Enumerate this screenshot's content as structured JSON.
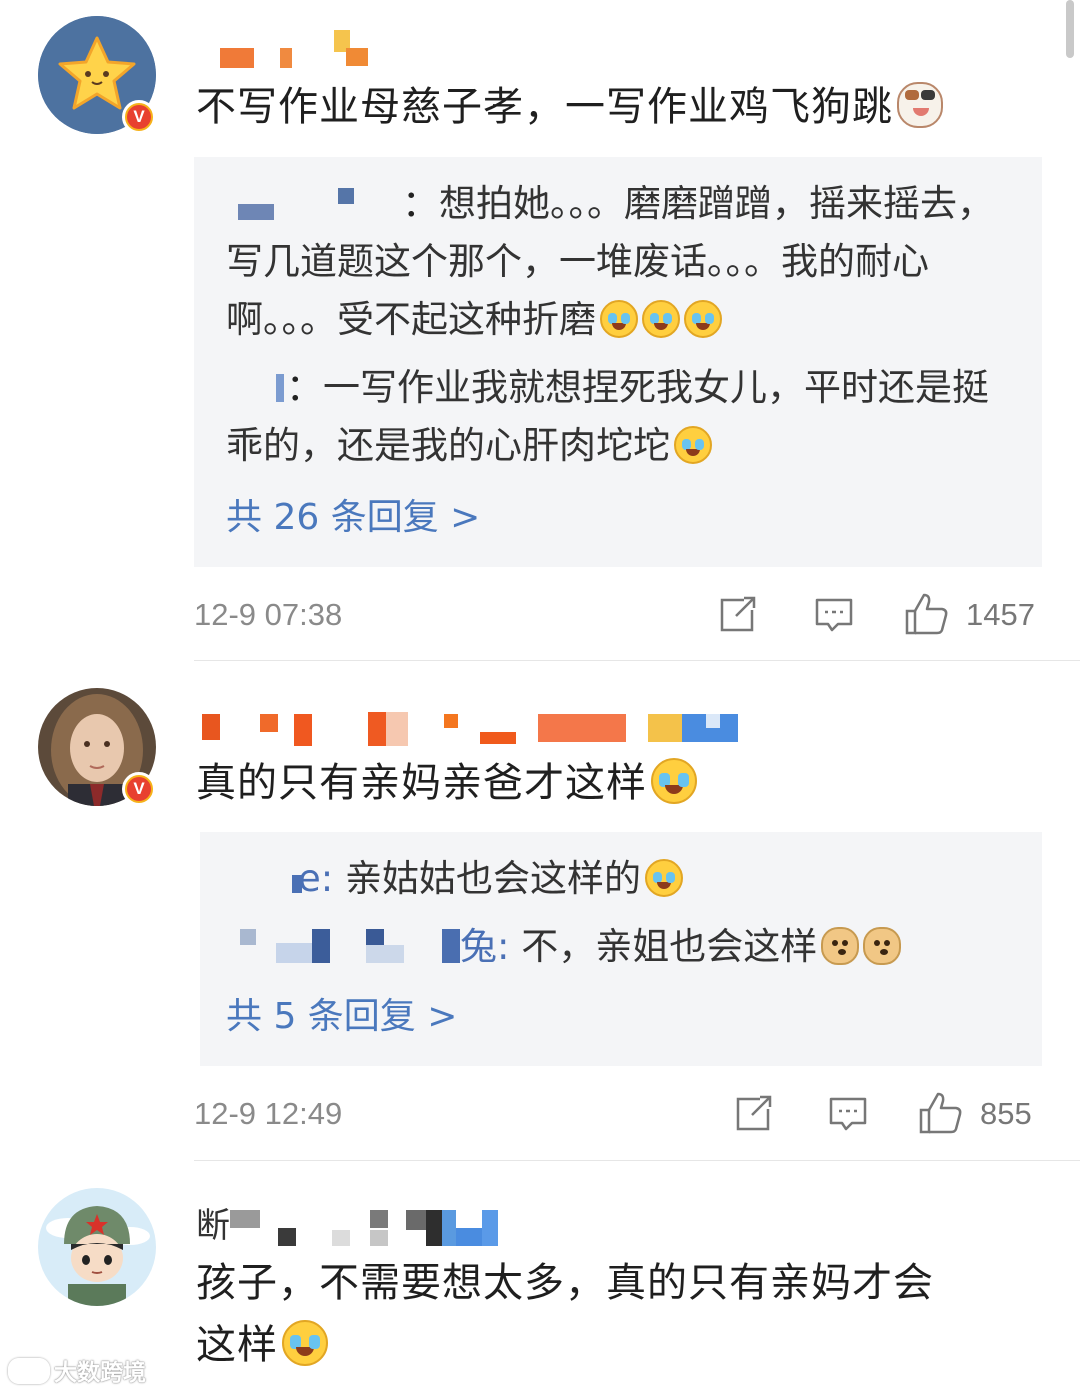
{
  "comments": [
    {
      "text": "不写作业母慈子孝，一写作业鸡飞狗跳",
      "replies": [
        {
          "name": "：",
          "text": "想拍她。。。磨磨蹭蹭，摇来摇去，写几道题这个那个，一堆废话。。。我的耐心啊。。。受不起这种折磨"
        },
        {
          "name": "：",
          "text": "一写作业我就想捏死我女儿，平时还是挺乖的，还是我的心肝肉坨坨"
        }
      ],
      "more_replies": "共 26 条回复 >",
      "time": "12-9 07:38",
      "likes": "1457"
    },
    {
      "text": "真的只有亲妈亲爸才这样",
      "replies": [
        {
          "name": "e: ",
          "text": "亲姑姑也会这样的"
        },
        {
          "name": "兔: ",
          "text": "不，亲姐也会这样"
        }
      ],
      "more_replies": "共 5 条回复 >",
      "time": "12-9 12:49",
      "likes": "855"
    },
    {
      "name_partial": "断",
      "text_line1": "孩子，不需要想太多，真的只有亲妈才会",
      "text_line2": "这样"
    }
  ],
  "watermark": "大数跨境",
  "icons": [
    "repost-icon",
    "comment-icon",
    "like-icon",
    "cry-laugh-emoji",
    "doge-emoji",
    "cat-emoji",
    "verified-badge-icon"
  ],
  "colors": {
    "link": "#4a78bd",
    "reply_bg": "#f4f5f7",
    "badge": "#e8402f"
  }
}
